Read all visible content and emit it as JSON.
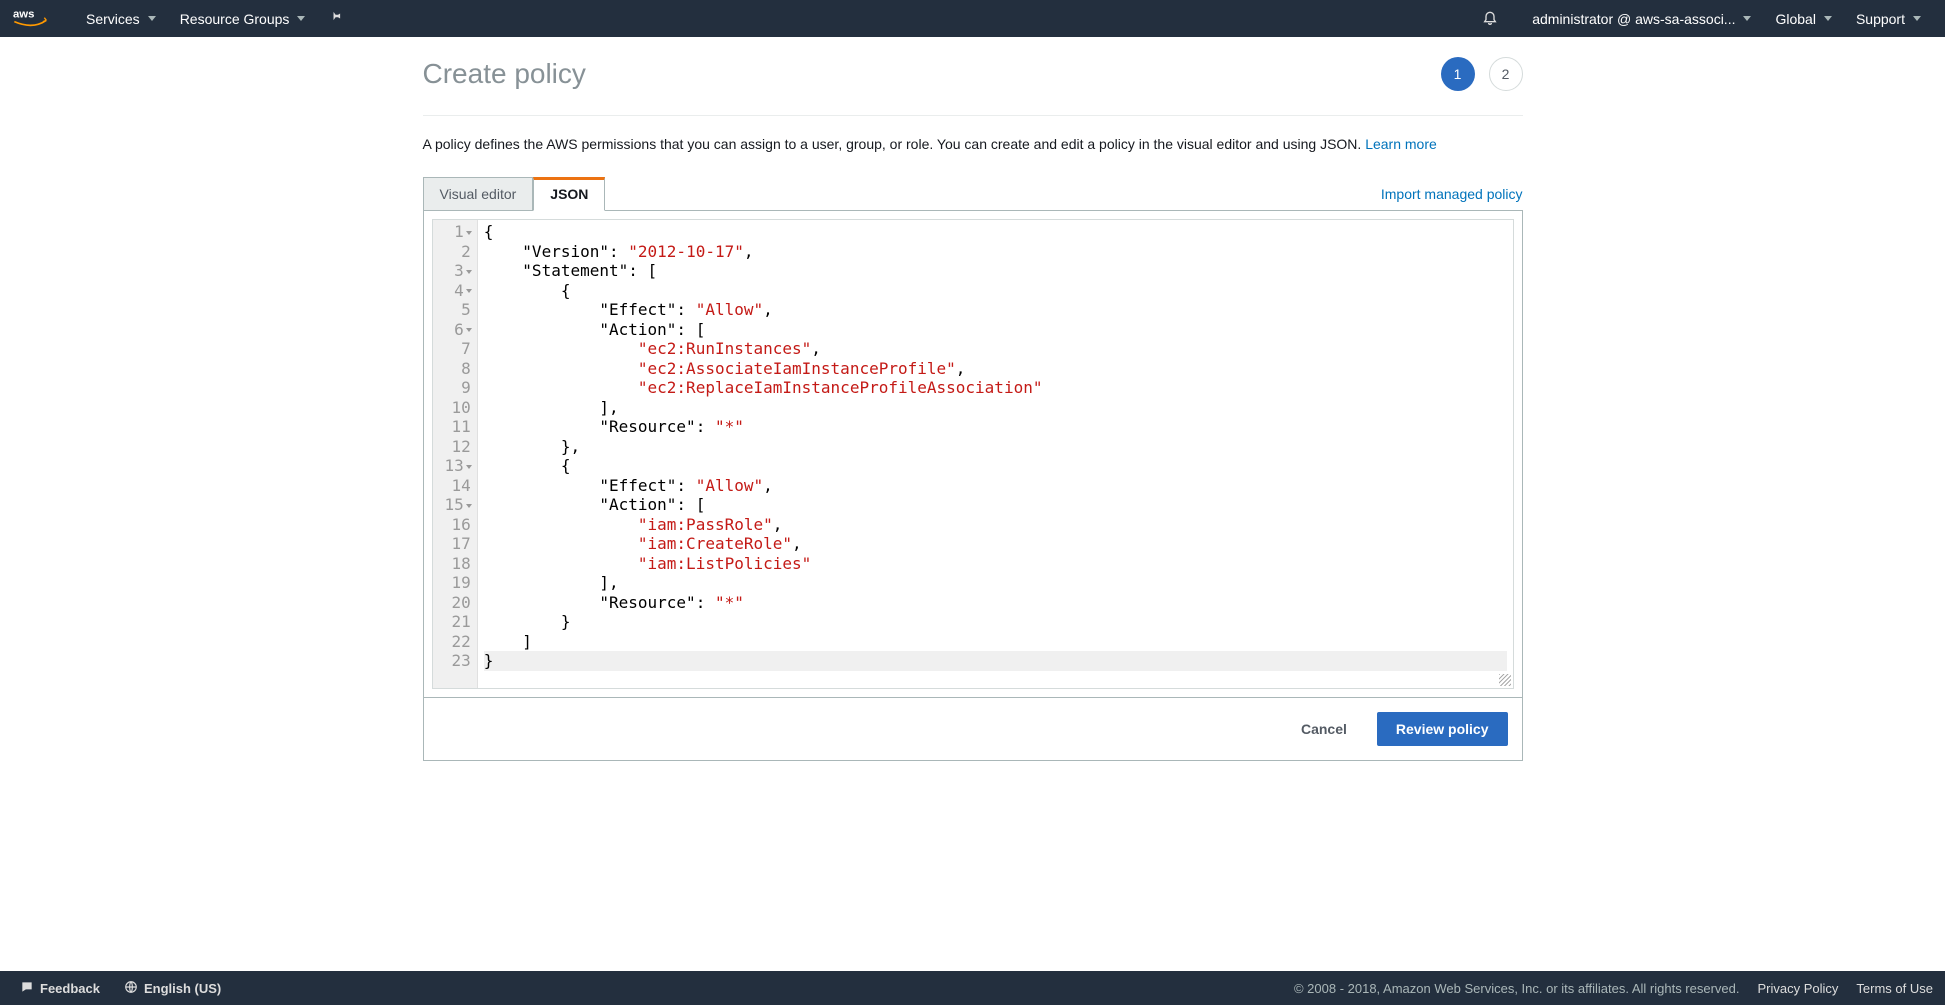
{
  "nav": {
    "services": "Services",
    "resource_groups": "Resource Groups",
    "account": "administrator @ aws-sa-associ...",
    "region": "Global",
    "support": "Support"
  },
  "page": {
    "title": "Create policy",
    "description_pre": "A policy defines the AWS permissions that you can assign to a user, group, or role. You can create and edit a policy in the visual editor and using JSON. ",
    "learn_more": "Learn more"
  },
  "steps": {
    "one": "1",
    "two": "2"
  },
  "tabs": {
    "visual": "Visual editor",
    "json": "JSON"
  },
  "import_link": "Import managed policy",
  "policy_json": {
    "Version": "2012-10-17",
    "Statement": [
      {
        "Effect": "Allow",
        "Action": [
          "ec2:RunInstances",
          "ec2:AssociateIamInstanceProfile",
          "ec2:ReplaceIamInstanceProfileAssociation"
        ],
        "Resource": "*"
      },
      {
        "Effect": "Allow",
        "Action": [
          "iam:PassRole",
          "iam:CreateRole",
          "iam:ListPolicies"
        ],
        "Resource": "*"
      }
    ]
  },
  "gutter_lines": [
    {
      "n": "1",
      "fold": true
    },
    {
      "n": "2",
      "fold": false
    },
    {
      "n": "3",
      "fold": true
    },
    {
      "n": "4",
      "fold": true
    },
    {
      "n": "5",
      "fold": false
    },
    {
      "n": "6",
      "fold": true
    },
    {
      "n": "7",
      "fold": false
    },
    {
      "n": "8",
      "fold": false
    },
    {
      "n": "9",
      "fold": false
    },
    {
      "n": "10",
      "fold": false
    },
    {
      "n": "11",
      "fold": false
    },
    {
      "n": "12",
      "fold": false
    },
    {
      "n": "13",
      "fold": true
    },
    {
      "n": "14",
      "fold": false
    },
    {
      "n": "15",
      "fold": true
    },
    {
      "n": "16",
      "fold": false
    },
    {
      "n": "17",
      "fold": false
    },
    {
      "n": "18",
      "fold": false
    },
    {
      "n": "19",
      "fold": false
    },
    {
      "n": "20",
      "fold": false
    },
    {
      "n": "21",
      "fold": false
    },
    {
      "n": "22",
      "fold": false
    },
    {
      "n": "23",
      "fold": false
    }
  ],
  "actions": {
    "cancel": "Cancel",
    "review": "Review policy"
  },
  "footer": {
    "feedback": "Feedback",
    "language": "English (US)",
    "copyright": "© 2008 - 2018, Amazon Web Services, Inc. or its affiliates. All rights reserved.",
    "privacy": "Privacy Policy",
    "terms": "Terms of Use"
  }
}
